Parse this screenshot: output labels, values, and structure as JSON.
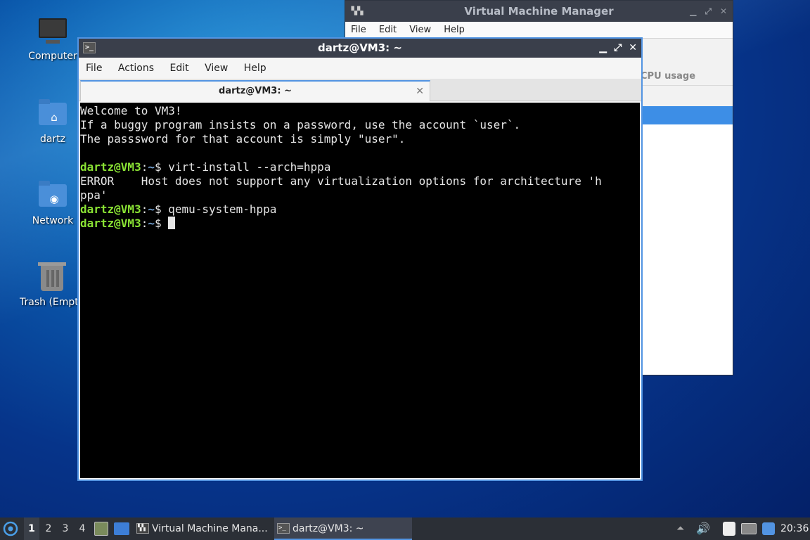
{
  "desktop": {
    "icons": [
      {
        "label": "Computer",
        "icon": "monitor-icon"
      },
      {
        "label": "dartz",
        "icon": "home-folder-icon"
      },
      {
        "label": "Network",
        "icon": "network-folder-icon"
      },
      {
        "label": "Trash (Empty)",
        "icon": "trash-icon"
      }
    ]
  },
  "vmm": {
    "title": "Virtual Machine Manager",
    "menu": [
      "File",
      "Edit",
      "View",
      "Help"
    ],
    "column_header": "CPU usage"
  },
  "terminal": {
    "title": "dartz@VM3: ~",
    "menu": [
      "File",
      "Actions",
      "Edit",
      "View",
      "Help"
    ],
    "tab_label": "dartz@VM3: ~",
    "lines": [
      "Welcome to VM3!",
      "If a buggy program insists on a password, use the account `user`.",
      "The passsword for that account is simply \"user\".",
      ""
    ],
    "prompt_user": "dartz@VM3",
    "prompt_sep": ":",
    "prompt_path": "~",
    "prompt_end": "$ ",
    "cmd1": "virt-install --arch=hppa",
    "error_line1": "ERROR    Host does not support any virtualization options for architecture 'h",
    "error_line2": "ppa'",
    "cmd2": "qemu-system-hppa",
    "cmd3": ""
  },
  "taskbar": {
    "workspaces": [
      "1",
      "2",
      "3",
      "4"
    ],
    "active_workspace": "1",
    "apps": [
      {
        "label": "Virtual Machine Mana...",
        "active": false
      },
      {
        "label": "dartz@VM3: ~",
        "active": true
      }
    ],
    "clock": "20:36",
    "accent": "#5294e2"
  }
}
